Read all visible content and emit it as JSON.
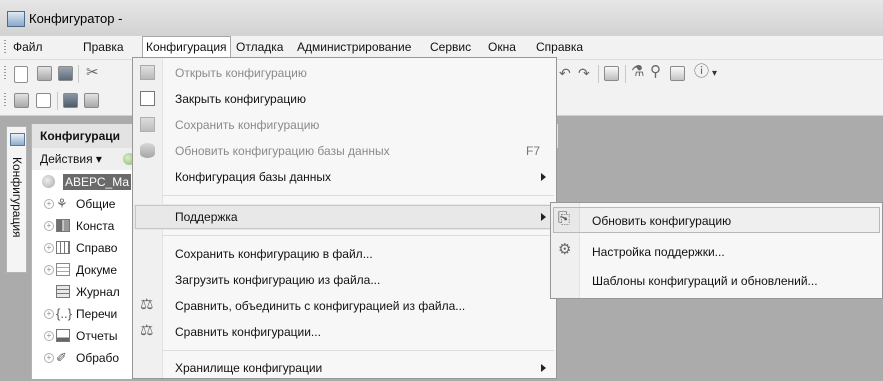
{
  "window": {
    "title": "Конфигуратор -"
  },
  "menubar": {
    "items": [
      "Файл",
      "Правка",
      "Конфигурация",
      "Отладка",
      "Администрирование",
      "Сервис",
      "Окна",
      "Справка"
    ]
  },
  "sidebar": {
    "tab_label": "Конфигурация"
  },
  "panel": {
    "title": "Конфигураци",
    "actions_label": "Действия ▾",
    "tree": [
      {
        "label": "АВЕРС_Ма",
        "icon": "circle-icon"
      },
      {
        "label": "Общие",
        "icon": "common-icon"
      },
      {
        "label": "Конста",
        "icon": "constants-icon"
      },
      {
        "label": "Справо",
        "icon": "catalogs-icon"
      },
      {
        "label": "Докуме",
        "icon": "documents-icon"
      },
      {
        "label": "Журнал",
        "icon": "journal-icon"
      },
      {
        "label": "Перечи",
        "icon": "enums-icon"
      },
      {
        "label": "Отчеты",
        "icon": "reports-icon"
      },
      {
        "label": "Обрабо",
        "icon": "processing-icon"
      }
    ]
  },
  "config_menu": {
    "items": [
      {
        "label": "Открыть конфигурацию",
        "enabled": false
      },
      {
        "label": "Закрыть конфигурацию",
        "enabled": true
      },
      {
        "label": "Сохранить конфигурацию",
        "enabled": false
      },
      {
        "label": "Обновить конфигурацию базы данных",
        "enabled": false,
        "shortcut": "F7"
      },
      {
        "label": "Конфигурация базы данных",
        "enabled": true,
        "submenu": true
      },
      {
        "label": "Поддержка",
        "enabled": true,
        "submenu": true,
        "highlighted": true
      },
      {
        "label": "Сохранить конфигурацию в файл...",
        "enabled": true
      },
      {
        "label": "Загрузить конфигурацию из файла...",
        "enabled": true
      },
      {
        "label": "Сравнить, объединить с конфигурацией из файла...",
        "enabled": true
      },
      {
        "label": "Сравнить конфигурации...",
        "enabled": true
      },
      {
        "label": "Хранилище конфигурации",
        "enabled": true,
        "submenu": true
      }
    ]
  },
  "support_submenu": {
    "items": [
      {
        "label": "Обновить конфигурацию",
        "highlighted": true
      },
      {
        "label": "Настройка поддержки..."
      },
      {
        "label": "Шаблоны конфигураций и обновлений..."
      }
    ]
  }
}
